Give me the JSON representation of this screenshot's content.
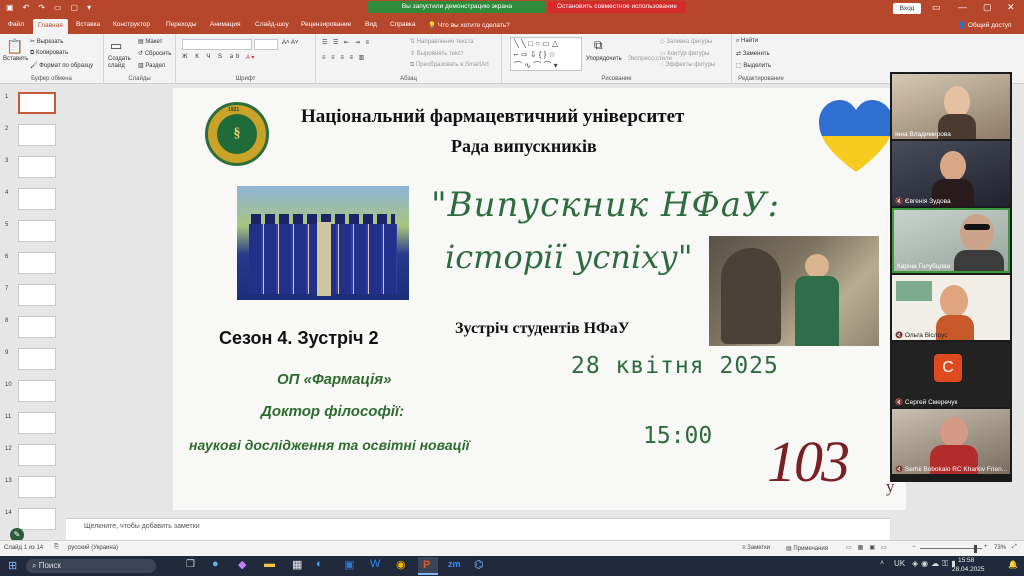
{
  "titlebar": {
    "share_banner": "Вы запустили демонстрацию экрана",
    "stop_banner": "Остановить совместное использование",
    "login": "Вход"
  },
  "tabs": [
    "Файл",
    "Главная",
    "Вставка",
    "Конструктор",
    "Переходы",
    "Анимация",
    "Слайд-шоу",
    "Рецензирование",
    "Вид",
    "Справка",
    "Что вы хотите сделать?"
  ],
  "share_label": "Общий доступ",
  "ribbon": {
    "paste": "Вставить",
    "cut": "Вырезать",
    "copy": "Копировать",
    "format_painter": "Формат по образцу",
    "clipboard": "Буфер обмена",
    "new_slide": "Создать слайд",
    "layout": "Макет",
    "reset": "Сбросить",
    "section": "Раздел",
    "slides": "Слайды",
    "font": "Шрифт",
    "text_direction": "Направление текста",
    "align_text": "Выровнять текст",
    "smartart": "Преобразовать в SmartArt",
    "paragraph": "Абзац",
    "arrange": "Упорядочить",
    "quick_styles": "Экспресс-стили",
    "shape_fill": "Заливка фигуры",
    "shape_outline": "Контур фигуры",
    "shape_effects": "Эффекты фигуры",
    "drawing": "Рисование",
    "find": "Найти",
    "replace": "Заменить",
    "select": "Выделить",
    "editing": "Редактирование"
  },
  "thumbnails": [
    "1",
    "2",
    "3",
    "4",
    "5",
    "6",
    "7",
    "8",
    "9",
    "10",
    "11",
    "12",
    "13",
    "14"
  ],
  "slide": {
    "university": "Національний фармацевтичний університет",
    "council": "Рада випускників",
    "big_line1": "\"Випускник НФаУ:",
    "big_line2": "історії успіху\"",
    "meeting": "Зустріч студентів НФаУ",
    "season": "Сезон 4. Зустріч 2",
    "op": "ОП «Фармація»",
    "doctor": "Доктор філософії:",
    "research": "наукові дослідження та освітні новації",
    "date": "28 квітня 2025",
    "time": "15:00",
    "anniversary": "103",
    "anniversary_suffix": "у",
    "logo_year": "1921"
  },
  "notes_placeholder": "Щелкните, чтобы добавить заметки",
  "participants": [
    "Інна Владимирова",
    "Євгенія Зудова",
    "Каріна Голубцова",
    "Ольга Віслоус",
    "Сергей Смеречук",
    "Serhii Bobokalo RC Kharkiv Frien..."
  ],
  "participant_avatar_letter": "С",
  "status": {
    "slide_info": "Слайд 1 из 14",
    "language": "русский (Украина)",
    "notes_btn": "Заметки",
    "comments_btn": "Примечания",
    "zoom": "73%"
  },
  "taskbar": {
    "search": "Поиск",
    "lang": "UK",
    "time": "15:58",
    "date": "28.04.2025"
  },
  "colors": {
    "brand": "#b7472a",
    "slide_green": "#2e6b3d",
    "accent_red": "#7a1f24"
  }
}
